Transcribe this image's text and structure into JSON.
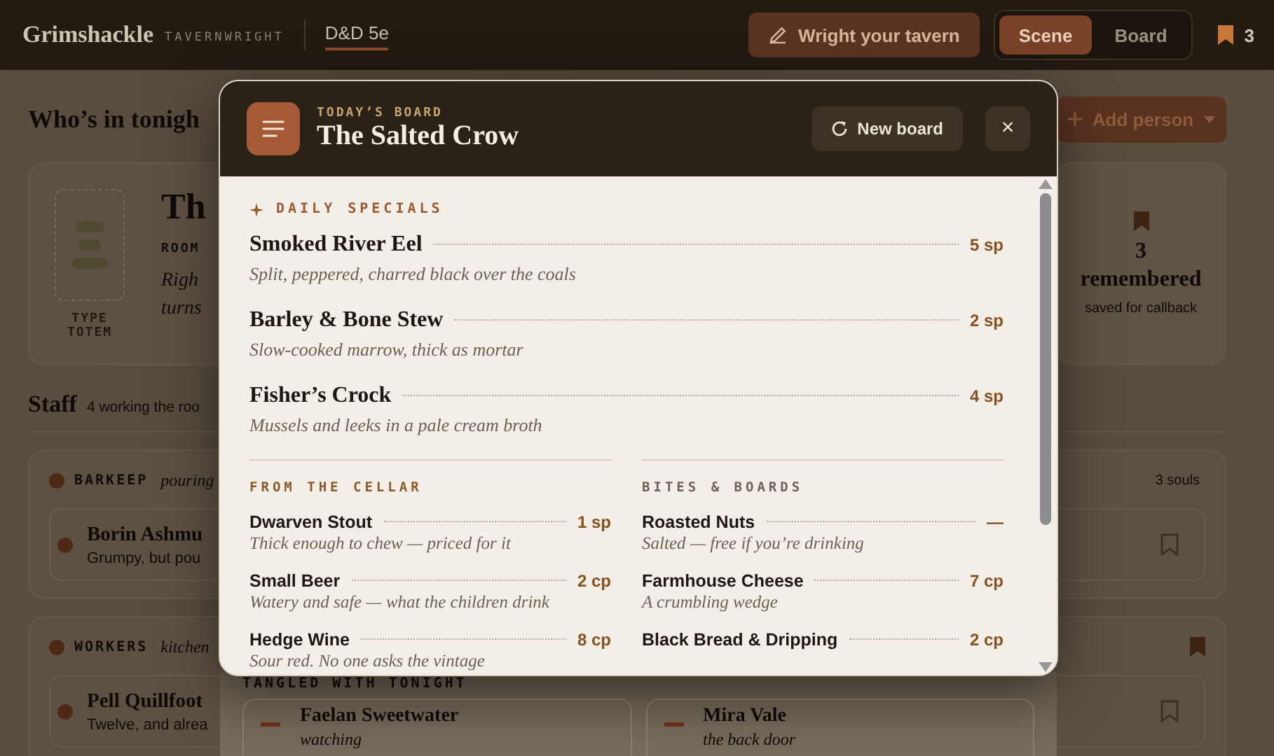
{
  "topbar": {
    "brand": "Grimshackle",
    "brand_sub": "TAVERNWRIGHT",
    "edition": "D&D 5e",
    "wright_button": "Wright your tavern",
    "view_tabs": [
      {
        "label": "Scene",
        "selected": true
      },
      {
        "label": "Board",
        "selected": false
      }
    ],
    "bookmark_count": "3"
  },
  "background": {
    "heading": "Who’s in tonigh",
    "add_button": "Add person",
    "room_card": {
      "totem_label": "TYPE TOTEM",
      "title": "Th",
      "label": "ROOM",
      "lines": [
        "Righ",
        "turns"
      ]
    },
    "remembered": {
      "count": "3",
      "label": "remembered",
      "note": "saved for callback"
    },
    "staff": {
      "title": "Staff",
      "note": "4 working the roo"
    },
    "groups": [
      {
        "name": "BARKEEP",
        "note": "pouring",
        "count": "3 souls",
        "bookmarked": false,
        "people": [
          {
            "name": "Borin Ashmu",
            "note": "Grumpy, but pou",
            "bookmarked": false
          }
        ]
      },
      {
        "name": "WORKERS",
        "note": "kitchen",
        "bookmarked": true,
        "people": [
          {
            "name": "Pell Quillfoot",
            "note": "Twelve, and alrea",
            "bookmarked": false
          }
        ]
      }
    ],
    "tangled": {
      "title": "TANGLED WITH TONIGHT",
      "people": [
        {
          "name": "Faelan Sweetwater",
          "note": "watching"
        },
        {
          "name": "Mira Vale",
          "note": "the back door"
        }
      ]
    }
  },
  "modal": {
    "eyebrow": "TODAY’S BOARD",
    "title": "The Salted Crow",
    "new_board": "New board",
    "close": "×",
    "specials": {
      "title": "DAILY SPECIALS",
      "items": [
        {
          "name": "Smoked River Eel",
          "desc": "Split, peppered, charred black over the coals",
          "price": "5 sp"
        },
        {
          "name": "Barley & Bone Stew",
          "desc": "Slow-cooked marrow, thick as mortar",
          "price": "2 sp"
        },
        {
          "name": "Fisher’s Crock",
          "desc": "Mussels and leeks in a pale cream broth",
          "price": "4 sp"
        }
      ]
    },
    "columns": [
      {
        "title": "FROM THE CELLAR",
        "accent": true,
        "items": [
          {
            "name": "Dwarven Stout",
            "desc": "Thick enough to chew — priced for it",
            "price": "1 sp"
          },
          {
            "name": "Small Beer",
            "desc": "Watery and safe — what the children drink",
            "price": "2 cp"
          },
          {
            "name": "Hedge Wine",
            "desc": "Sour red. No one asks the vintage",
            "price": "8 cp"
          }
        ]
      },
      {
        "title": "BITES & BOARDS",
        "accent": false,
        "items": [
          {
            "name": "Roasted Nuts",
            "desc": "Salted — free if you’re drinking",
            "price": "—"
          },
          {
            "name": "Farmhouse Cheese",
            "desc": "A crumbling wedge",
            "price": "7 cp"
          },
          {
            "name": "Black Bread & Dripping",
            "price": "2 cp"
          }
        ]
      }
    ]
  }
}
